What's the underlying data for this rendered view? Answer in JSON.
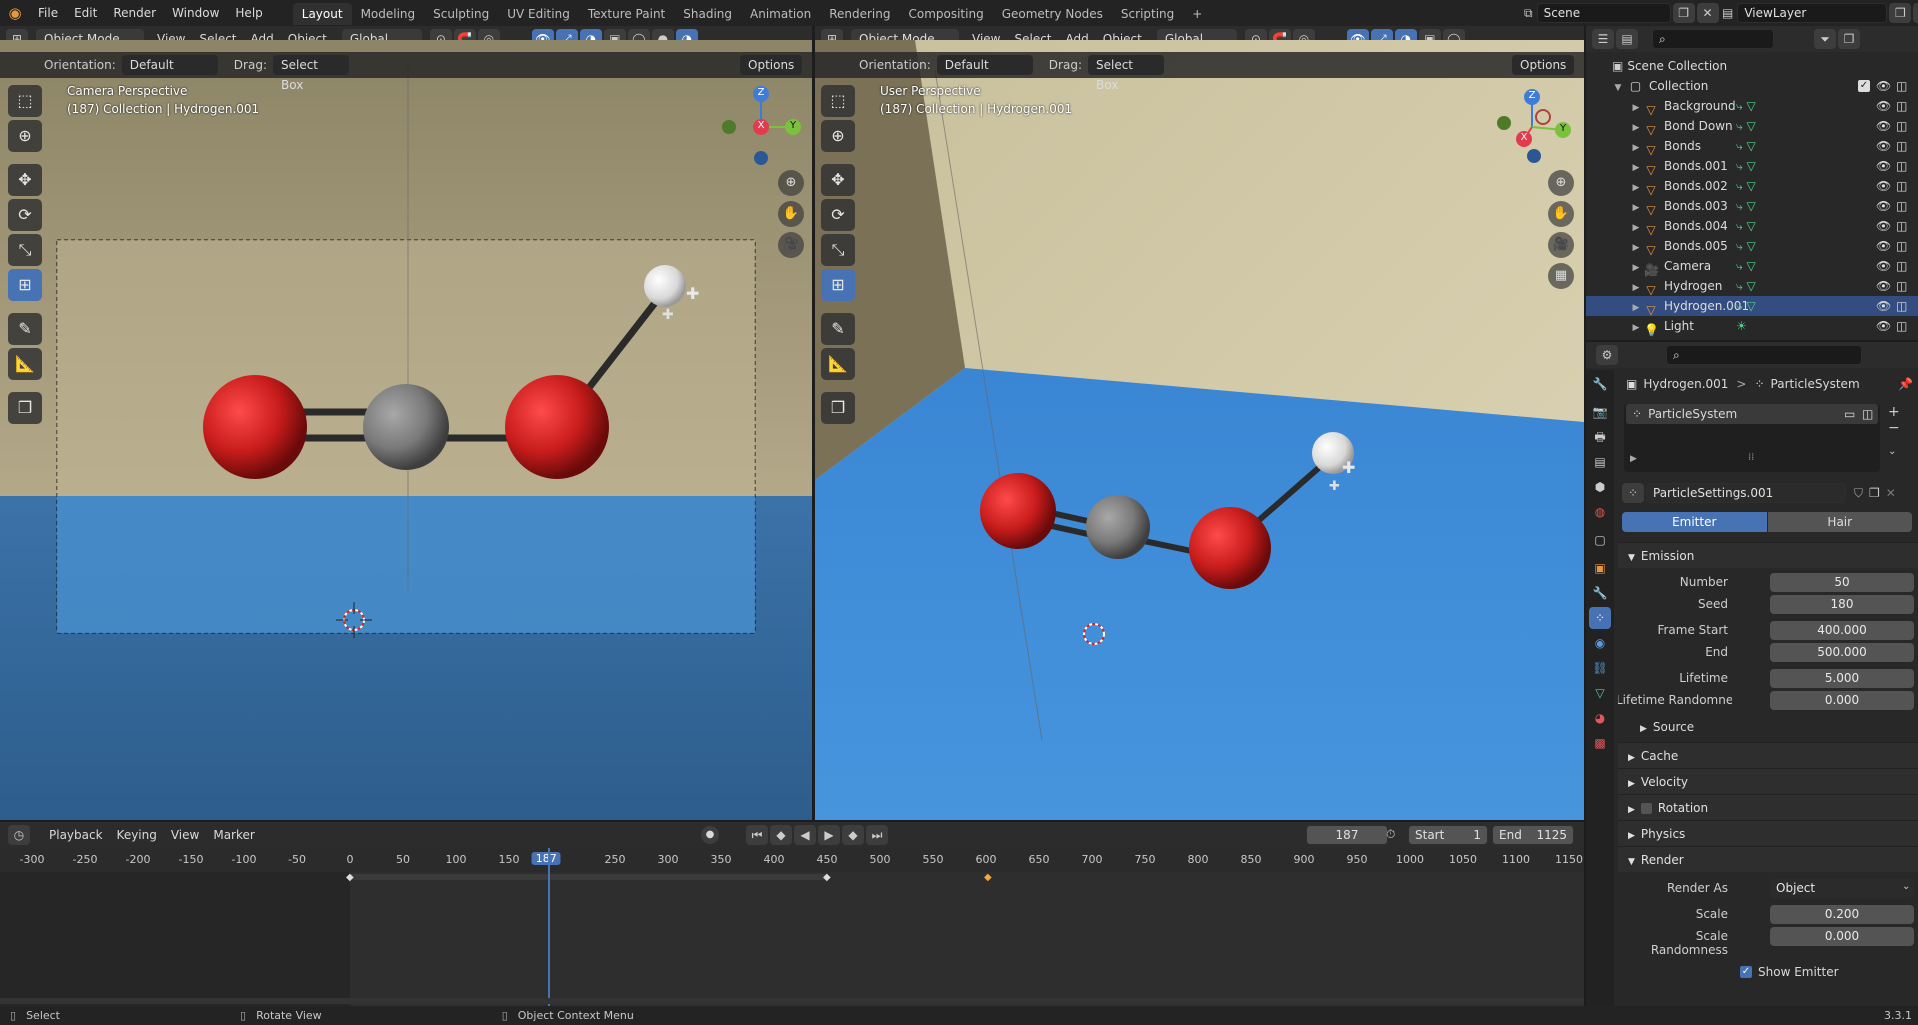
{
  "app": {
    "menu": [
      "File",
      "Edit",
      "Render",
      "Window",
      "Help"
    ],
    "workspaces": [
      "Layout",
      "Modeling",
      "Sculpting",
      "UV Editing",
      "Texture Paint",
      "Shading",
      "Animation",
      "Rendering",
      "Compositing",
      "Geometry Nodes",
      "Scripting"
    ],
    "active_workspace": "Layout",
    "add_workspace": "+",
    "scene": "Scene",
    "view_layer": "ViewLayer"
  },
  "viewport_header": {
    "mode": "Object Mode",
    "menus": [
      "View",
      "Select",
      "Add",
      "Object"
    ],
    "transform": "Global",
    "orientation_label": "Orientation:",
    "orientation_value": "Default",
    "drag_label": "Drag:",
    "drag_value": "Select Box",
    "options": "Options"
  },
  "viewport_left": {
    "title": "Camera Perspective",
    "subtitle": "(187) Collection | Hydrogen.001",
    "gizmo": {
      "z": "Z",
      "x": "X",
      "y": "Y"
    }
  },
  "viewport_right": {
    "title": "User Perspective",
    "subtitle": "(187) Collection | Hydrogen.001",
    "gizmo": {
      "z": "Z",
      "x": "X",
      "y": "Y"
    }
  },
  "outliner": {
    "search_placeholder": "",
    "root": "Scene Collection",
    "collection": "Collection",
    "items": [
      {
        "name": "Background",
        "type": "mesh",
        "selected": false
      },
      {
        "name": "Bond Down",
        "type": "mesh",
        "selected": false
      },
      {
        "name": "Bonds",
        "type": "mesh",
        "selected": false
      },
      {
        "name": "Bonds.001",
        "type": "mesh",
        "selected": false
      },
      {
        "name": "Bonds.002",
        "type": "mesh",
        "selected": false
      },
      {
        "name": "Bonds.003",
        "type": "mesh",
        "selected": false
      },
      {
        "name": "Bonds.004",
        "type": "mesh",
        "selected": false
      },
      {
        "name": "Bonds.005",
        "type": "mesh",
        "selected": false
      },
      {
        "name": "Camera",
        "type": "camera",
        "selected": false
      },
      {
        "name": "Hydrogen",
        "type": "mesh",
        "selected": false
      },
      {
        "name": "Hydrogen.001",
        "type": "mesh",
        "selected": true
      },
      {
        "name": "Light",
        "type": "light",
        "selected": false
      }
    ]
  },
  "properties": {
    "breadcrumb_object": "Hydrogen.001",
    "breadcrumb_sep": ">",
    "breadcrumb_system": "ParticleSystem",
    "particle_system": "ParticleSystem",
    "settings": "ParticleSettings.001",
    "type_tabs": [
      "Emitter",
      "Hair"
    ],
    "active_type": "Emitter",
    "emission": {
      "header": "Emission",
      "rows": [
        {
          "label": "Number",
          "value": "50",
          "dot": false
        },
        {
          "label": "Seed",
          "value": "180",
          "dot": true
        },
        {
          "label": "Frame Start",
          "value": "400.000",
          "dot": true
        },
        {
          "label": "End",
          "value": "500.000",
          "dot": true
        },
        {
          "label": "Lifetime",
          "value": "5.000",
          "dot": true
        },
        {
          "label": "Lifetime Randomness",
          "value": "0.000",
          "dot": true
        }
      ],
      "source": "Source"
    },
    "collapsed_panels": [
      "Cache",
      "Velocity",
      "Rotation",
      "Physics"
    ],
    "render": {
      "header": "Render",
      "render_as_label": "Render As",
      "render_as_value": "Object",
      "scale_label": "Scale",
      "scale_value": "0.200",
      "scale_random_label": "Scale Randomness",
      "scale_random_value": "0.000",
      "show_emitter": "Show Emitter"
    }
  },
  "timeline": {
    "menus": [
      "Playback",
      "Keying",
      "View",
      "Marker"
    ],
    "current_frame": "187",
    "start_label": "Start",
    "start_value": "1",
    "end_label": "End",
    "end_value": "1125",
    "ticks": [
      "-300",
      "-250",
      "-200",
      "-150",
      "-100",
      "-50",
      "0",
      "50",
      "100",
      "150",
      "187",
      "250",
      "300",
      "350",
      "400",
      "450",
      "500",
      "550",
      "600",
      "650",
      "700",
      "750",
      "800",
      "850",
      "900",
      "950",
      "1000",
      "1050",
      "1100",
      "1150"
    ]
  },
  "status": {
    "items": [
      "Select",
      "Rotate View",
      "Object Context Menu"
    ],
    "version": "3.3.1"
  }
}
